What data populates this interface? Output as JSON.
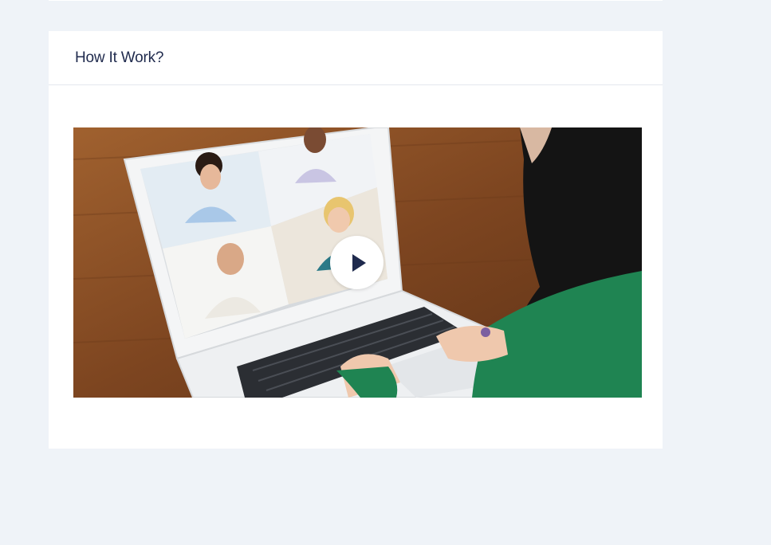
{
  "section": {
    "title": "How It Work?"
  },
  "video": {
    "thumbnail": "laptop-video-conference",
    "play_icon": "play-icon"
  }
}
